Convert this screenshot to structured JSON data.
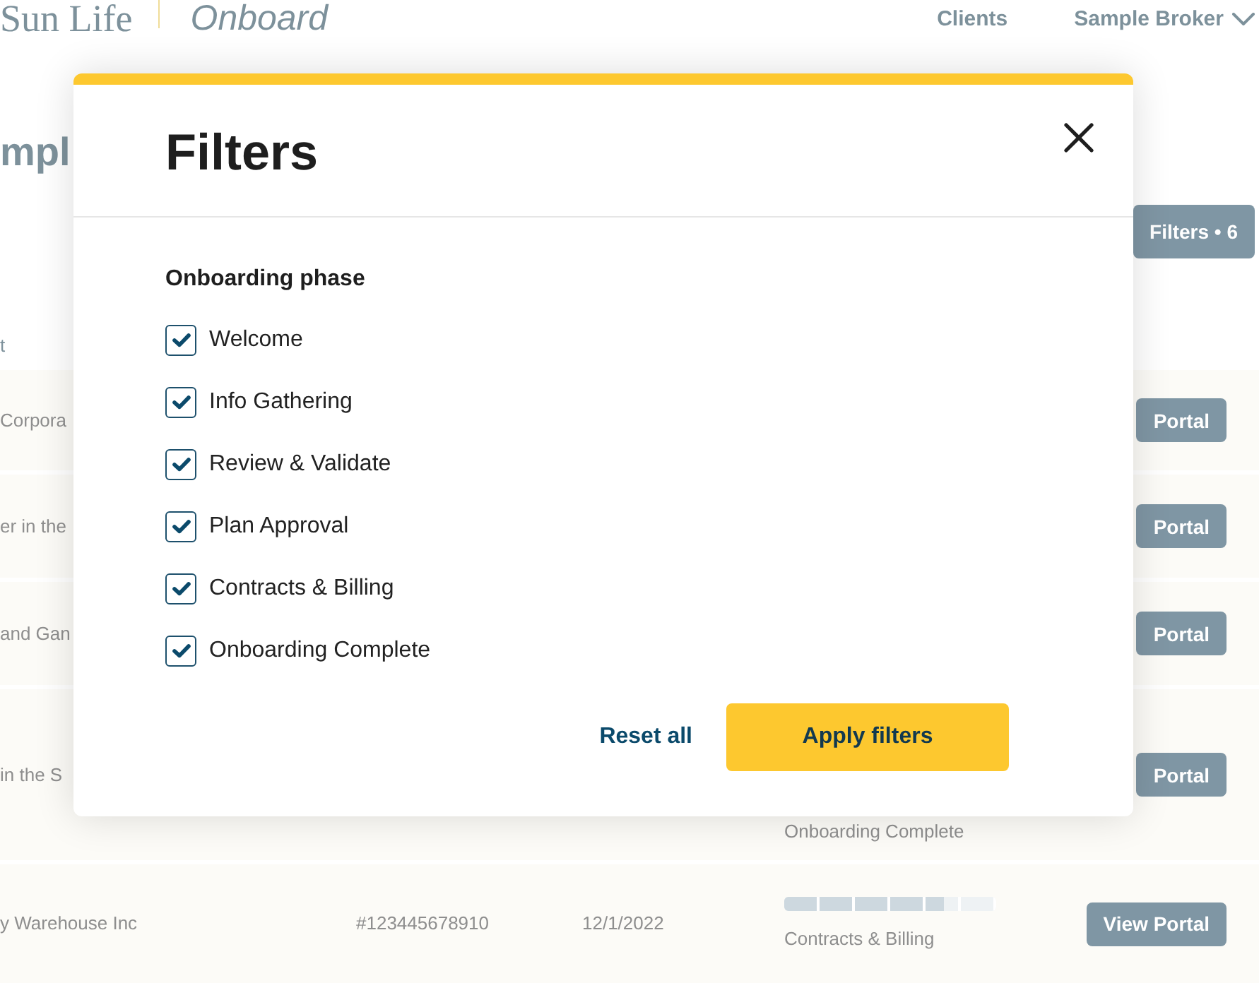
{
  "header": {
    "logo": "Sun Life",
    "product": "Onboard",
    "nav": [
      {
        "label": "Clients"
      }
    ],
    "account": {
      "label": "Sample Broker"
    }
  },
  "page": {
    "title": "mpl",
    "filters_button": "Filters • 6"
  },
  "table": {
    "columns": [
      {
        "label": "t"
      }
    ],
    "rows": [
      {
        "name": "Corpora",
        "action": "Portal"
      },
      {
        "name": "er in the",
        "action": "Portal"
      },
      {
        "name": "and Gan",
        "action": "Portal"
      },
      {
        "name": "in the S",
        "phase": "Onboarding Complete",
        "action": "Portal"
      },
      {
        "name": "y Warehouse Inc",
        "number": "#123445678910",
        "date": "12/1/2022",
        "progress": {
          "level": 0.75
        },
        "phase": "Contracts & Billing",
        "action": "View Portal"
      }
    ]
  },
  "dialog": {
    "title": "Filters",
    "section": "Onboarding phase",
    "options": [
      {
        "label": "Welcome",
        "checked": true
      },
      {
        "label": "Info Gathering",
        "checked": true
      },
      {
        "label": "Review & Validate",
        "checked": true
      },
      {
        "label": "Plan Approval",
        "checked": true
      },
      {
        "label": "Contracts & Billing",
        "checked": true
      },
      {
        "label": "Onboarding Complete",
        "checked": true
      }
    ],
    "reset": "Reset all",
    "apply": "Apply filters"
  }
}
